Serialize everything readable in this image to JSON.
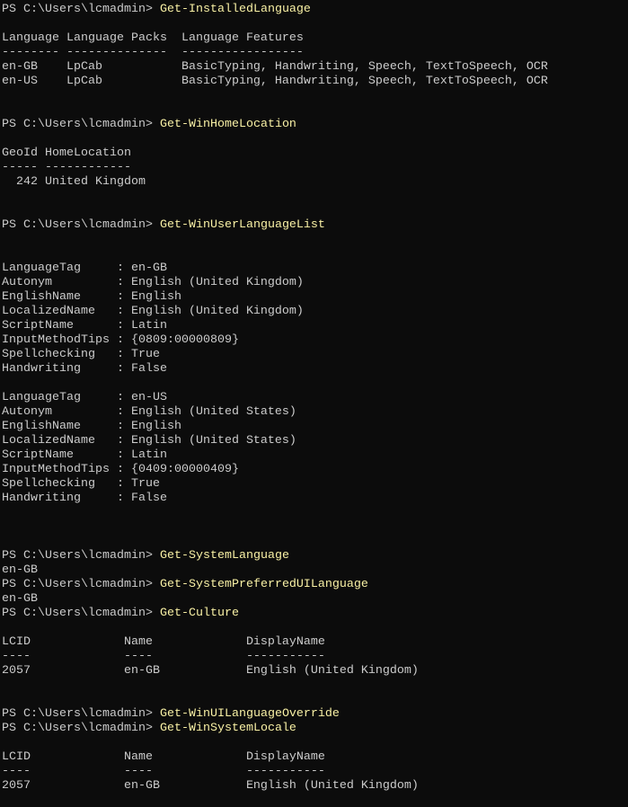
{
  "colors": {
    "background": "#0c0c0c",
    "output": "#cccccc",
    "command": "#f9f1a5"
  },
  "prompt": "PS C:\\Users\\lcmadmin> ",
  "lines": [
    {
      "cmd": "Get-InstalledLanguage"
    },
    {
      "text": ""
    },
    {
      "text": "Language Language Packs  Language Features"
    },
    {
      "text": "-------- --------------  -----------------"
    },
    {
      "text": "en-GB    LpCab           BasicTyping, Handwriting, Speech, TextToSpeech, OCR"
    },
    {
      "text": "en-US    LpCab           BasicTyping, Handwriting, Speech, TextToSpeech, OCR"
    },
    {
      "text": ""
    },
    {
      "text": ""
    },
    {
      "cmd": "Get-WinHomeLocation"
    },
    {
      "text": ""
    },
    {
      "text": "GeoId HomeLocation"
    },
    {
      "text": "----- ------------"
    },
    {
      "text": "  242 United Kingdom"
    },
    {
      "text": ""
    },
    {
      "text": ""
    },
    {
      "cmd": "Get-WinUserLanguageList"
    },
    {
      "text": ""
    },
    {
      "text": ""
    },
    {
      "text": "LanguageTag     : en-GB"
    },
    {
      "text": "Autonym         : English (United Kingdom)"
    },
    {
      "text": "EnglishName     : English"
    },
    {
      "text": "LocalizedName   : English (United Kingdom)"
    },
    {
      "text": "ScriptName      : Latin"
    },
    {
      "text": "InputMethodTips : {0809:00000809}"
    },
    {
      "text": "Spellchecking   : True"
    },
    {
      "text": "Handwriting     : False"
    },
    {
      "text": ""
    },
    {
      "text": "LanguageTag     : en-US"
    },
    {
      "text": "Autonym         : English (United States)"
    },
    {
      "text": "EnglishName     : English"
    },
    {
      "text": "LocalizedName   : English (United States)"
    },
    {
      "text": "ScriptName      : Latin"
    },
    {
      "text": "InputMethodTips : {0409:00000409}"
    },
    {
      "text": "Spellchecking   : True"
    },
    {
      "text": "Handwriting     : False"
    },
    {
      "text": ""
    },
    {
      "text": ""
    },
    {
      "text": ""
    },
    {
      "cmd": "Get-SystemLanguage"
    },
    {
      "text": "en-GB"
    },
    {
      "cmd": "Get-SystemPreferredUILanguage"
    },
    {
      "text": "en-GB"
    },
    {
      "cmd": "Get-Culture"
    },
    {
      "text": ""
    },
    {
      "text": "LCID             Name             DisplayName"
    },
    {
      "text": "----             ----             -----------"
    },
    {
      "text": "2057             en-GB            English (United Kingdom)"
    },
    {
      "text": ""
    },
    {
      "text": ""
    },
    {
      "cmd": "Get-WinUILanguageOverride"
    },
    {
      "cmd": "Get-WinSystemLocale"
    },
    {
      "text": ""
    },
    {
      "text": "LCID             Name             DisplayName"
    },
    {
      "text": "----             ----             -----------"
    },
    {
      "text": "2057             en-GB            English (United Kingdom)"
    }
  ]
}
